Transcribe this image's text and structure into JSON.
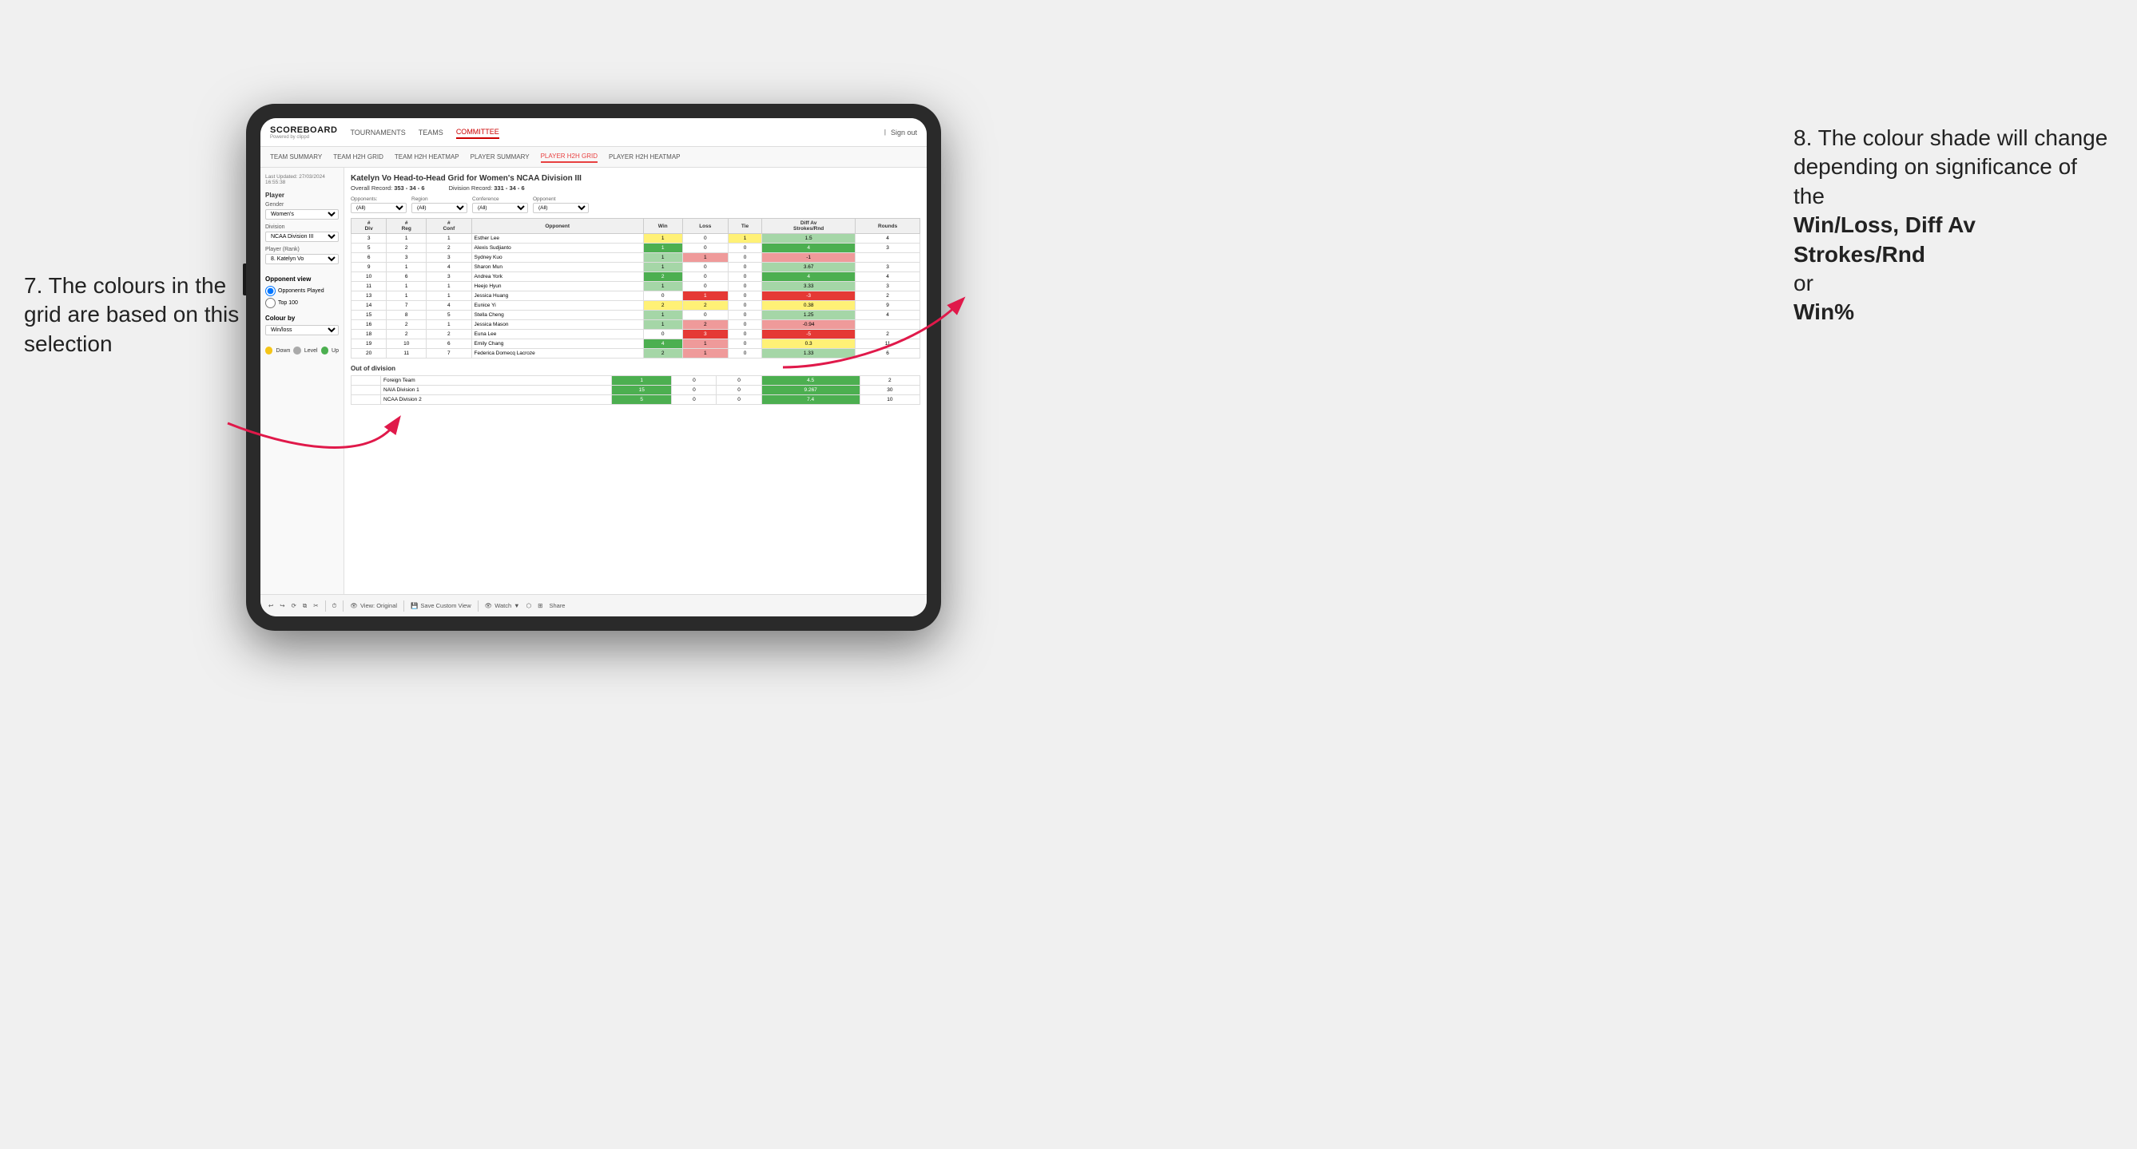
{
  "annotations": {
    "left_title": "7. The colours in the grid are based on this selection",
    "right_title": "8. The colour shade will change depending on significance of the",
    "right_bold1": "Win/Loss, Diff Av Strokes/Rnd",
    "right_or": "or",
    "right_bold2": "Win%"
  },
  "nav": {
    "logo": "SCOREBOARD",
    "logo_sub": "Powered by clippd",
    "items": [
      "TOURNAMENTS",
      "TEAMS",
      "COMMITTEE"
    ],
    "active": "COMMITTEE",
    "sign_out": "Sign out"
  },
  "sub_nav": {
    "items": [
      "TEAM SUMMARY",
      "TEAM H2H GRID",
      "TEAM H2H HEATMAP",
      "PLAYER SUMMARY",
      "PLAYER H2H GRID",
      "PLAYER H2H HEATMAP"
    ],
    "active": "PLAYER H2H GRID"
  },
  "sidebar": {
    "timestamp": "Last Updated: 27/03/2024 16:55:38",
    "player_title": "Player",
    "gender_label": "Gender",
    "gender_value": "Women's",
    "division_label": "Division",
    "division_value": "NCAA Division III",
    "player_rank_label": "Player (Rank)",
    "player_rank_value": "8. Katelyn Vo",
    "opponent_view_title": "Opponent view",
    "radio_opponents": "Opponents Played",
    "radio_top100": "Top 100",
    "colour_by_title": "Colour by",
    "colour_by_value": "Win/loss",
    "legend_down": "Down",
    "legend_level": "Level",
    "legend_up": "Up"
  },
  "grid": {
    "title": "Katelyn Vo Head-to-Head Grid for Women's NCAA Division III",
    "overall_record_label": "Overall Record:",
    "overall_record_value": "353 - 34 - 6",
    "division_record_label": "Division Record:",
    "division_record_value": "331 - 34 - 6",
    "filter_opponents_label": "Opponents:",
    "filter_region_label": "Region",
    "filter_conference_label": "Conference",
    "filter_opponent_label": "Opponent",
    "filter_all": "(All)",
    "col_headers": [
      "#\nDiv",
      "#\nReg",
      "#\nConf",
      "Opponent",
      "Win",
      "Loss",
      "Tie",
      "Diff Av\nStrokes/Rnd",
      "Rounds"
    ],
    "rows": [
      {
        "div": 3,
        "reg": 1,
        "conf": 1,
        "opponent": "Esther Lee",
        "win": 1,
        "loss": 0,
        "tie": 1,
        "diff": 1.5,
        "rounds": 4,
        "win_color": "yellow",
        "loss_color": "white",
        "tie_color": "yellow",
        "diff_color": "green_light"
      },
      {
        "div": 5,
        "reg": 2,
        "conf": 2,
        "opponent": "Alexis Sudjianto",
        "win": 1,
        "loss": 0,
        "tie": 0,
        "diff": 4.0,
        "rounds": 3,
        "win_color": "green_dark",
        "loss_color": "white",
        "tie_color": "white",
        "diff_color": "green_dark"
      },
      {
        "div": 6,
        "reg": 3,
        "conf": 3,
        "opponent": "Sydney Kuo",
        "win": 1,
        "loss": 1,
        "tie": 0,
        "diff": -1.0,
        "rounds": "",
        "win_color": "green_light",
        "loss_color": "red_light",
        "tie_color": "white",
        "diff_color": "red_light"
      },
      {
        "div": 9,
        "reg": 1,
        "conf": 4,
        "opponent": "Sharon Mun",
        "win": 1,
        "loss": 0,
        "tie": 0,
        "diff": 3.67,
        "rounds": 3,
        "win_color": "green_light",
        "loss_color": "white",
        "tie_color": "white",
        "diff_color": "green_light"
      },
      {
        "div": 10,
        "reg": 6,
        "conf": 3,
        "opponent": "Andrea York",
        "win": 2,
        "loss": 0,
        "tie": 0,
        "diff": 4.0,
        "rounds": 4,
        "win_color": "green_dark",
        "loss_color": "white",
        "tie_color": "white",
        "diff_color": "green_dark"
      },
      {
        "div": 11,
        "reg": 1,
        "conf": 1,
        "opponent": "Heejo Hyun",
        "win": 1,
        "loss": 0,
        "tie": 0,
        "diff": 3.33,
        "rounds": 3,
        "win_color": "green_light",
        "loss_color": "white",
        "tie_color": "white",
        "diff_color": "green_light"
      },
      {
        "div": 13,
        "reg": 1,
        "conf": 1,
        "opponent": "Jessica Huang",
        "win": 0,
        "loss": 1,
        "tie": 0,
        "diff": -3.0,
        "rounds": 2,
        "win_color": "white",
        "loss_color": "red_dark",
        "tie_color": "white",
        "diff_color": "red_dark"
      },
      {
        "div": 14,
        "reg": 7,
        "conf": 4,
        "opponent": "Eunice Yi",
        "win": 2,
        "loss": 2,
        "tie": 0,
        "diff": 0.38,
        "rounds": 9,
        "win_color": "yellow",
        "loss_color": "yellow",
        "tie_color": "white",
        "diff_color": "yellow"
      },
      {
        "div": 15,
        "reg": 8,
        "conf": 5,
        "opponent": "Stella Cheng",
        "win": 1,
        "loss": 0,
        "tie": 0,
        "diff": 1.25,
        "rounds": 4,
        "win_color": "green_light",
        "loss_color": "white",
        "tie_color": "white",
        "diff_color": "green_light"
      },
      {
        "div": 16,
        "reg": 2,
        "conf": 1,
        "opponent": "Jessica Mason",
        "win": 1,
        "loss": 2,
        "tie": 0,
        "diff": -0.94,
        "rounds": "",
        "win_color": "green_light",
        "loss_color": "red_light",
        "tie_color": "white",
        "diff_color": "red_light"
      },
      {
        "div": 18,
        "reg": 2,
        "conf": 2,
        "opponent": "Euna Lee",
        "win": 0,
        "loss": 3,
        "tie": 0,
        "diff": -5.0,
        "rounds": 2,
        "win_color": "white",
        "loss_color": "red_dark",
        "tie_color": "white",
        "diff_color": "red_dark"
      },
      {
        "div": 19,
        "reg": 10,
        "conf": 6,
        "opponent": "Emily Chang",
        "win": 4,
        "loss": 1,
        "tie": 0,
        "diff": 0.3,
        "rounds": 11,
        "win_color": "green_dark",
        "loss_color": "red_light",
        "tie_color": "white",
        "diff_color": "yellow"
      },
      {
        "div": 20,
        "reg": 11,
        "conf": 7,
        "opponent": "Federica Domecq Lacroze",
        "win": 2,
        "loss": 1,
        "tie": 0,
        "diff": 1.33,
        "rounds": 6,
        "win_color": "green_light",
        "loss_color": "red_light",
        "tie_color": "white",
        "diff_color": "green_light"
      }
    ],
    "out_of_division_title": "Out of division",
    "out_of_division_rows": [
      {
        "label": "Foreign Team",
        "win": 1,
        "loss": 0,
        "tie": 0,
        "diff": 4.5,
        "rounds": 2,
        "win_color": "green_dark",
        "loss_color": "white",
        "tie_color": "white",
        "diff_color": "green_dark"
      },
      {
        "label": "NAIA Division 1",
        "win": 15,
        "loss": 0,
        "tie": 0,
        "diff": 9.267,
        "rounds": 30,
        "win_color": "green_dark",
        "loss_color": "white",
        "tie_color": "white",
        "diff_color": "green_dark"
      },
      {
        "label": "NCAA Division 2",
        "win": 5,
        "loss": 0,
        "tie": 0,
        "diff": 7.4,
        "rounds": 10,
        "win_color": "green_dark",
        "loss_color": "white",
        "tie_color": "white",
        "diff_color": "green_dark"
      }
    ]
  },
  "toolbar": {
    "view_original": "View: Original",
    "save_custom_view": "Save Custom View",
    "watch": "Watch",
    "share": "Share"
  }
}
